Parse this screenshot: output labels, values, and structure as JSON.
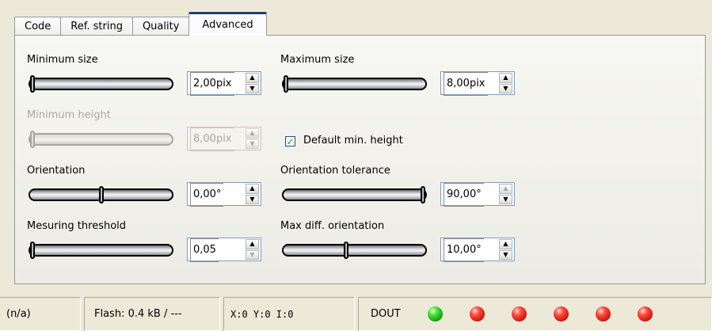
{
  "tabs": [
    {
      "label": "Code"
    },
    {
      "label": "Ref. string"
    },
    {
      "label": "Quality"
    },
    {
      "label": "Advanced",
      "active": true
    }
  ],
  "advanced": {
    "min_size": {
      "label": "Minimum size",
      "value": "2,00pix",
      "slider_level": 0.0
    },
    "max_size": {
      "label": "Maximum size",
      "value": "8,00pix",
      "slider_level": 0.0
    },
    "min_height": {
      "label": "Minimum height",
      "value": "8,00pix",
      "slider_level": 0.0,
      "disabled": true
    },
    "default_min_height": {
      "label": "Default min. height",
      "checked": true
    },
    "orientation": {
      "label": "Orientation",
      "value": "0,00°",
      "slider_level": 0.5
    },
    "orientation_tolerance": {
      "label": "Orientation tolerance",
      "value": "90,00°",
      "slider_level": 1.0
    },
    "measuring_threshold": {
      "label": "Mesuring threshold",
      "value": "0,05",
      "slider_level": 0.0
    },
    "max_diff_orientation": {
      "label": "Max diff. orientation",
      "value": "10,00°",
      "slider_level": 0.44
    }
  },
  "statusbar": {
    "state": "(n/a)",
    "flash": "Flash:  0.4 kB / ---",
    "coords": "X:0 Y:0 I:0",
    "dout_label": "DOUT",
    "leds": [
      "green",
      "red",
      "red",
      "red",
      "red",
      "red"
    ]
  },
  "colors": {
    "led_green": "#2fd022",
    "led_red": "#e5180f",
    "active_tab_accent": "#1c3f7a"
  }
}
